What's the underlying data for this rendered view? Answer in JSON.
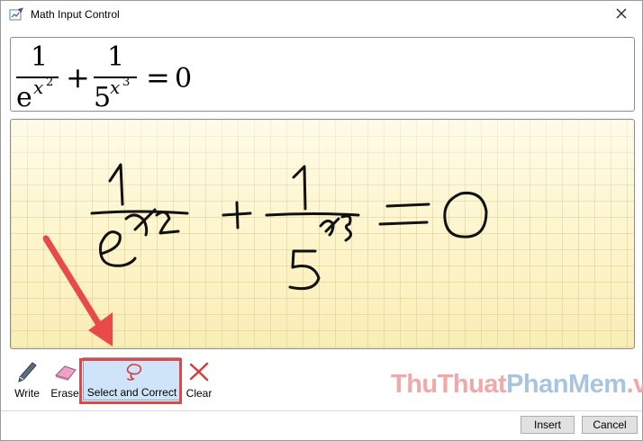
{
  "window": {
    "title": "Math Input Control",
    "icons": {
      "app": "math-input-app-icon",
      "close": "close-icon"
    }
  },
  "preview": {
    "term1": {
      "numerator": "1",
      "base": "e",
      "exp_var": "x",
      "exp_power": "2"
    },
    "plus": "+",
    "term2": {
      "numerator": "1",
      "base": "5",
      "exp_var": "x",
      "exp_power": "3"
    },
    "equals": "=",
    "rhs": "0"
  },
  "toolbar": {
    "write_label": "Write",
    "erase_label": "Erase",
    "select_label": "Select and Correct",
    "clear_label": "Clear",
    "icons": {
      "write": "pen-icon",
      "erase": "eraser-icon",
      "select": "lasso-icon",
      "clear": "clear-x-icon"
    }
  },
  "watermark": {
    "part1": "ThuThuat",
    "part2": "PhanMem",
    "part3": ".vn"
  },
  "footer": {
    "insert_label": "Insert",
    "cancel_label": "Cancel"
  },
  "colors": {
    "highlight_frame": "#e04848",
    "selected_tool_bg": "#cfe4f8",
    "canvas_bg": "#fdf6cf",
    "arrow": "#e84a4a"
  }
}
